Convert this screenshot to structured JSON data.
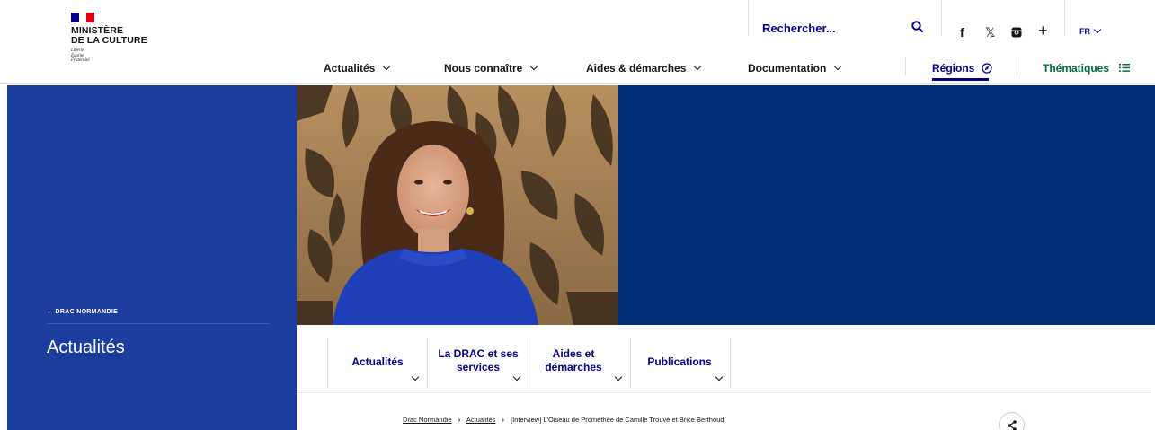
{
  "colors": {
    "brand_blue": "#000091",
    "hero_left": "#1a3d9e",
    "hero_right": "#002f7a",
    "thematiques_green": "#00694a",
    "marianne_red": "#e1000f"
  },
  "logo": {
    "line1": "MINISTÈRE",
    "line2": "DE LA CULTURE",
    "motto1": "Liberté",
    "motto2": "Égalité",
    "motto3": "Fraternité"
  },
  "header": {
    "search_placeholder": "Rechercher...",
    "search_icon": "search-icon",
    "social": [
      "f",
      "𝕏",
      "instagram-icon",
      "+"
    ],
    "lang": "FR"
  },
  "nav": {
    "items": [
      {
        "label": "Actualités"
      },
      {
        "label": "Nous connaître"
      },
      {
        "label": "Aides & démarches"
      },
      {
        "label": "Documentation"
      }
    ],
    "regions": "Régions",
    "thematiques": "Thématiques"
  },
  "hero": {
    "back_link": "← DRAC NORMANDIE",
    "title": "Actualités"
  },
  "subnav": {
    "items": [
      {
        "label": "Actualités"
      },
      {
        "label": "La DRAC et ses services"
      },
      {
        "label": "Aides et démarches"
      },
      {
        "label": "Publications"
      }
    ]
  },
  "breadcrumb": {
    "item1": "Drac Normandie",
    "item2": "Actualités",
    "current": "[Interview] L'Oiseau de Prométhée de Camille Trouvé et Brice Berthoud"
  }
}
